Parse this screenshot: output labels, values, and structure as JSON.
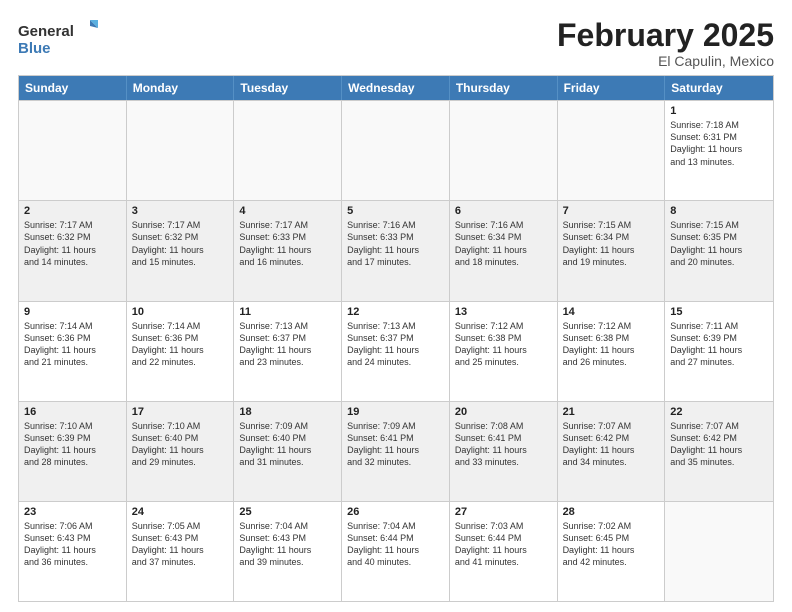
{
  "logo": {
    "line1": "General",
    "line2": "Blue"
  },
  "title": "February 2025",
  "location": "El Capulin, Mexico",
  "days": [
    "Sunday",
    "Monday",
    "Tuesday",
    "Wednesday",
    "Thursday",
    "Friday",
    "Saturday"
  ],
  "weeks": [
    [
      {
        "day": "",
        "text": ""
      },
      {
        "day": "",
        "text": ""
      },
      {
        "day": "",
        "text": ""
      },
      {
        "day": "",
        "text": ""
      },
      {
        "day": "",
        "text": ""
      },
      {
        "day": "",
        "text": ""
      },
      {
        "day": "1",
        "text": "Sunrise: 7:18 AM\nSunset: 6:31 PM\nDaylight: 11 hours\nand 13 minutes."
      }
    ],
    [
      {
        "day": "2",
        "text": "Sunrise: 7:17 AM\nSunset: 6:32 PM\nDaylight: 11 hours\nand 14 minutes."
      },
      {
        "day": "3",
        "text": "Sunrise: 7:17 AM\nSunset: 6:32 PM\nDaylight: 11 hours\nand 15 minutes."
      },
      {
        "day": "4",
        "text": "Sunrise: 7:17 AM\nSunset: 6:33 PM\nDaylight: 11 hours\nand 16 minutes."
      },
      {
        "day": "5",
        "text": "Sunrise: 7:16 AM\nSunset: 6:33 PM\nDaylight: 11 hours\nand 17 minutes."
      },
      {
        "day": "6",
        "text": "Sunrise: 7:16 AM\nSunset: 6:34 PM\nDaylight: 11 hours\nand 18 minutes."
      },
      {
        "day": "7",
        "text": "Sunrise: 7:15 AM\nSunset: 6:34 PM\nDaylight: 11 hours\nand 19 minutes."
      },
      {
        "day": "8",
        "text": "Sunrise: 7:15 AM\nSunset: 6:35 PM\nDaylight: 11 hours\nand 20 minutes."
      }
    ],
    [
      {
        "day": "9",
        "text": "Sunrise: 7:14 AM\nSunset: 6:36 PM\nDaylight: 11 hours\nand 21 minutes."
      },
      {
        "day": "10",
        "text": "Sunrise: 7:14 AM\nSunset: 6:36 PM\nDaylight: 11 hours\nand 22 minutes."
      },
      {
        "day": "11",
        "text": "Sunrise: 7:13 AM\nSunset: 6:37 PM\nDaylight: 11 hours\nand 23 minutes."
      },
      {
        "day": "12",
        "text": "Sunrise: 7:13 AM\nSunset: 6:37 PM\nDaylight: 11 hours\nand 24 minutes."
      },
      {
        "day": "13",
        "text": "Sunrise: 7:12 AM\nSunset: 6:38 PM\nDaylight: 11 hours\nand 25 minutes."
      },
      {
        "day": "14",
        "text": "Sunrise: 7:12 AM\nSunset: 6:38 PM\nDaylight: 11 hours\nand 26 minutes."
      },
      {
        "day": "15",
        "text": "Sunrise: 7:11 AM\nSunset: 6:39 PM\nDaylight: 11 hours\nand 27 minutes."
      }
    ],
    [
      {
        "day": "16",
        "text": "Sunrise: 7:10 AM\nSunset: 6:39 PM\nDaylight: 11 hours\nand 28 minutes."
      },
      {
        "day": "17",
        "text": "Sunrise: 7:10 AM\nSunset: 6:40 PM\nDaylight: 11 hours\nand 29 minutes."
      },
      {
        "day": "18",
        "text": "Sunrise: 7:09 AM\nSunset: 6:40 PM\nDaylight: 11 hours\nand 31 minutes."
      },
      {
        "day": "19",
        "text": "Sunrise: 7:09 AM\nSunset: 6:41 PM\nDaylight: 11 hours\nand 32 minutes."
      },
      {
        "day": "20",
        "text": "Sunrise: 7:08 AM\nSunset: 6:41 PM\nDaylight: 11 hours\nand 33 minutes."
      },
      {
        "day": "21",
        "text": "Sunrise: 7:07 AM\nSunset: 6:42 PM\nDaylight: 11 hours\nand 34 minutes."
      },
      {
        "day": "22",
        "text": "Sunrise: 7:07 AM\nSunset: 6:42 PM\nDaylight: 11 hours\nand 35 minutes."
      }
    ],
    [
      {
        "day": "23",
        "text": "Sunrise: 7:06 AM\nSunset: 6:43 PM\nDaylight: 11 hours\nand 36 minutes."
      },
      {
        "day": "24",
        "text": "Sunrise: 7:05 AM\nSunset: 6:43 PM\nDaylight: 11 hours\nand 37 minutes."
      },
      {
        "day": "25",
        "text": "Sunrise: 7:04 AM\nSunset: 6:43 PM\nDaylight: 11 hours\nand 39 minutes."
      },
      {
        "day": "26",
        "text": "Sunrise: 7:04 AM\nSunset: 6:44 PM\nDaylight: 11 hours\nand 40 minutes."
      },
      {
        "day": "27",
        "text": "Sunrise: 7:03 AM\nSunset: 6:44 PM\nDaylight: 11 hours\nand 41 minutes."
      },
      {
        "day": "28",
        "text": "Sunrise: 7:02 AM\nSunset: 6:45 PM\nDaylight: 11 hours\nand 42 minutes."
      },
      {
        "day": "",
        "text": ""
      }
    ]
  ]
}
